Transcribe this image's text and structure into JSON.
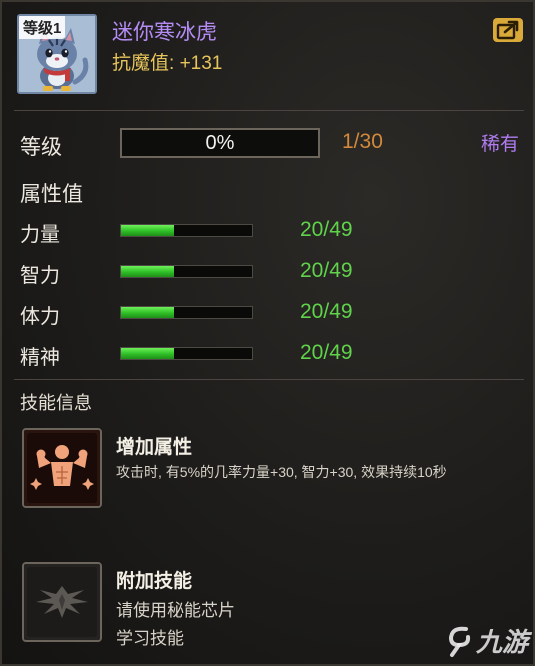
{
  "pet": {
    "level_tag": "等级1",
    "name": "迷你寒冰虎",
    "resist_label": "抗魔值:",
    "resist_value": "+131",
    "portrait_icon": "ice-tiger-portrait"
  },
  "share": {
    "icon": "share-export-icon"
  },
  "level": {
    "label": "等级",
    "progress_text": "0%",
    "progress": 0,
    "count": "1/30",
    "rarity": "稀有"
  },
  "attributes": {
    "title": "属性值",
    "stats": [
      {
        "label": "力量",
        "value": "20/49",
        "fill": 0.408
      },
      {
        "label": "智力",
        "value": "20/49",
        "fill": 0.408
      },
      {
        "label": "体力",
        "value": "20/49",
        "fill": 0.408
      },
      {
        "label": "精神",
        "value": "20/49",
        "fill": 0.408
      }
    ]
  },
  "skills": {
    "title": "技能信息",
    "items": [
      {
        "icon": "muscle-flex-icon",
        "name": "增加属性",
        "desc": "攻击时, 有5%的几率力量+30, 智力+30, 效果持续10秒"
      },
      {
        "icon": "wing-emblem-icon",
        "name": "附加技能",
        "desc_line1": "请使用秘能芯片",
        "desc_line2": "学习技能"
      }
    ]
  },
  "watermark": {
    "text": "九游"
  },
  "colors": {
    "name_purple": "#b58cf5",
    "resist_gold": "#e8c55c",
    "count_orange": "#d2893b",
    "stat_green": "#5fd34a",
    "rarity_purple": "#b07cf0"
  }
}
